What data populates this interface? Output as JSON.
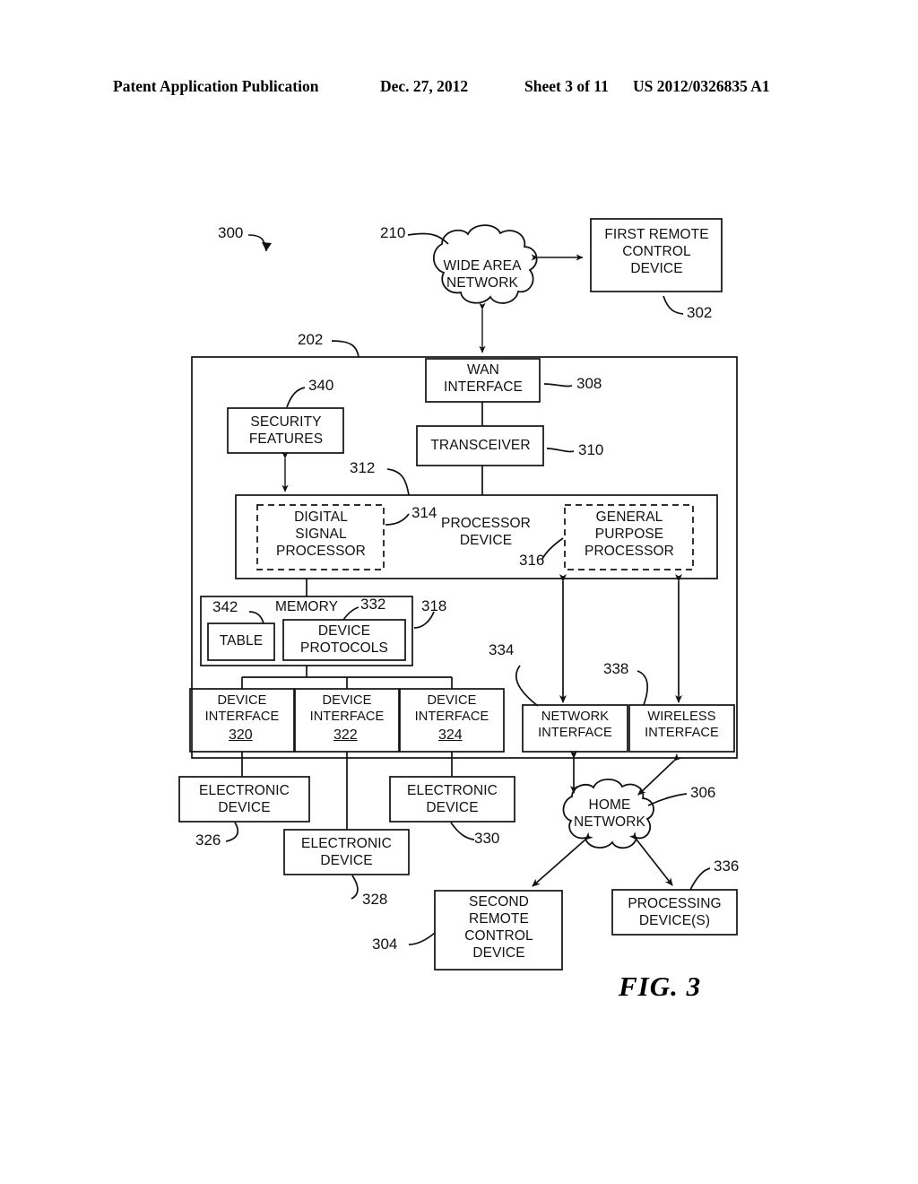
{
  "header": {
    "publication": "Patent Application Publication",
    "date": "Dec. 27, 2012",
    "sheet": "Sheet 3 of 11",
    "number": "US 2012/0326835 A1"
  },
  "figure": {
    "caption": "FIG. 3",
    "system_ref": "300"
  },
  "nodes": {
    "wide_area_network": {
      "label": "WIDE AREA\nNETWORK",
      "ref": "210",
      "shape": "cloud"
    },
    "first_remote_control": {
      "label": "FIRST REMOTE\nCONTROL\nDEVICE",
      "ref": "302",
      "shape": "box"
    },
    "gateway_container": {
      "ref": "202",
      "shape": "box"
    },
    "wan_interface": {
      "label": "WAN\nINTERFACE",
      "ref": "308",
      "shape": "box"
    },
    "security_features": {
      "label": "SECURITY\nFEATURES",
      "ref": "340",
      "shape": "box"
    },
    "transceiver": {
      "label": "TRANSCEIVER",
      "ref": "310",
      "shape": "box"
    },
    "processor_device": {
      "label": "PROCESSOR\nDEVICE",
      "ref": "312",
      "shape": "box"
    },
    "digital_signal_processor": {
      "label": "DIGITAL\nSIGNAL\nPROCESSOR",
      "ref": "314",
      "shape": "dashed-box"
    },
    "general_purpose_processor": {
      "label": "GENERAL\nPURPOSE\nPROCESSOR",
      "ref": "316",
      "shape": "dashed-box"
    },
    "memory": {
      "label": "MEMORY",
      "ref": "318",
      "shape": "box"
    },
    "table": {
      "label": "TABLE",
      "ref": "342",
      "shape": "box"
    },
    "device_protocols": {
      "label": "DEVICE\nPROTOCOLS",
      "ref": "332",
      "shape": "box"
    },
    "device_interface_1": {
      "label": "DEVICE\nINTERFACE",
      "ref": "320",
      "shape": "box"
    },
    "device_interface_2": {
      "label": "DEVICE\nINTERFACE",
      "ref": "322",
      "shape": "box"
    },
    "device_interface_3": {
      "label": "DEVICE\nINTERFACE",
      "ref": "324",
      "shape": "box"
    },
    "network_interface": {
      "label": "NETWORK\nINTERFACE",
      "ref": "334",
      "shape": "box"
    },
    "wireless_interface": {
      "label": "WIRELESS\nINTERFACE",
      "ref": "338",
      "shape": "box"
    },
    "electronic_device_1": {
      "label": "ELECTRONIC\nDEVICE",
      "ref": "326",
      "shape": "box"
    },
    "electronic_device_2": {
      "label": "ELECTRONIC\nDEVICE",
      "ref": "328",
      "shape": "box"
    },
    "electronic_device_3": {
      "label": "ELECTRONIC\nDEVICE",
      "ref": "330",
      "shape": "box"
    },
    "home_network": {
      "label": "HOME\nNETWORK",
      "ref": "306",
      "shape": "cloud"
    },
    "second_remote_control": {
      "label": "SECOND\nREMOTE\nCONTROL\nDEVICE",
      "ref": "304",
      "shape": "box"
    },
    "processing_devices": {
      "label": "PROCESSING\nDEVICE(S)",
      "ref": "336",
      "shape": "box"
    }
  },
  "colors": {
    "ink": "#111111",
    "paper": "#ffffff"
  }
}
